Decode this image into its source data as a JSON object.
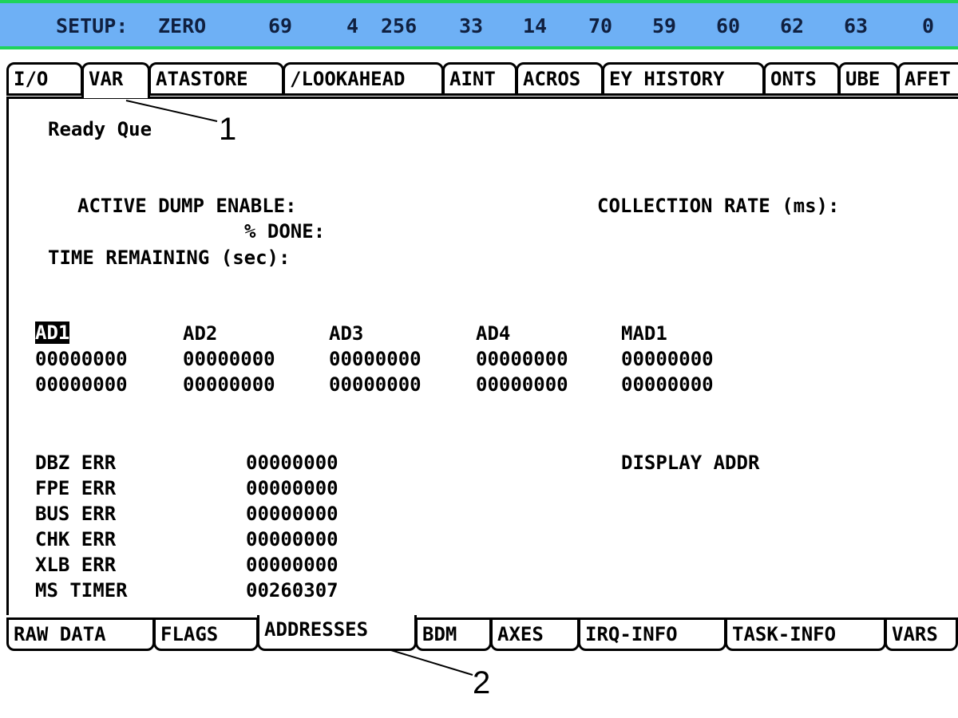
{
  "status_bar": {
    "label": "SETUP:",
    "mode": "ZERO",
    "values": [
      "69",
      "4",
      "256",
      "33",
      "14",
      "70",
      "59",
      "60",
      "62",
      "63",
      "0"
    ]
  },
  "top_tabs": [
    {
      "label": "I/O",
      "active": false
    },
    {
      "label": "VAR",
      "active": true
    },
    {
      "label": "ATASTORE",
      "active": false
    },
    {
      "label": "/LOOKAHEAD",
      "active": false
    },
    {
      "label": "AINT",
      "active": false
    },
    {
      "label": "ACROS",
      "active": false
    },
    {
      "label": "EY HISTORY",
      "active": false
    },
    {
      "label": "ONTS",
      "active": false
    },
    {
      "label": "UBE",
      "active": false
    },
    {
      "label": "AFET",
      "active": false
    }
  ],
  "main": {
    "status_text": "Ready Que",
    "dump": {
      "active_dump_enable_label": "ACTIVE DUMP ENABLE:",
      "percent_done_label": "% DONE:",
      "time_remaining_label": "TIME REMAINING (sec):",
      "collection_rate_label": "COLLECTION RATE (ms):"
    },
    "ad_table": {
      "headers": [
        "AD1",
        "AD2",
        "AD3",
        "AD4",
        "MAD1"
      ],
      "rows": [
        [
          "00000000",
          "00000000",
          "00000000",
          "00000000",
          "00000000"
        ],
        [
          "00000000",
          "00000000",
          "00000000",
          "00000000",
          "00000000"
        ]
      ]
    },
    "errors": [
      {
        "label": "DBZ ERR",
        "value": "00000000"
      },
      {
        "label": "FPE ERR",
        "value": "00000000"
      },
      {
        "label": "BUS ERR",
        "value": "00000000"
      },
      {
        "label": "CHK ERR",
        "value": "00000000"
      },
      {
        "label": "XLB ERR",
        "value": "00000000"
      },
      {
        "label": "MS TIMER",
        "value": "00260307"
      }
    ],
    "display_addr_label": "DISPLAY ADDR"
  },
  "bottom_tabs": [
    {
      "label": "RAW DATA",
      "active": false
    },
    {
      "label": "FLAGS",
      "active": false
    },
    {
      "label": "ADDRESSES",
      "active": true
    },
    {
      "label": "BDM",
      "active": false
    },
    {
      "label": "AXES",
      "active": false
    },
    {
      "label": "IRQ-INFO",
      "active": false
    },
    {
      "label": "TASK-INFO",
      "active": false
    },
    {
      "label": "VARS",
      "active": false
    }
  ],
  "callouts": [
    "1",
    "2"
  ]
}
